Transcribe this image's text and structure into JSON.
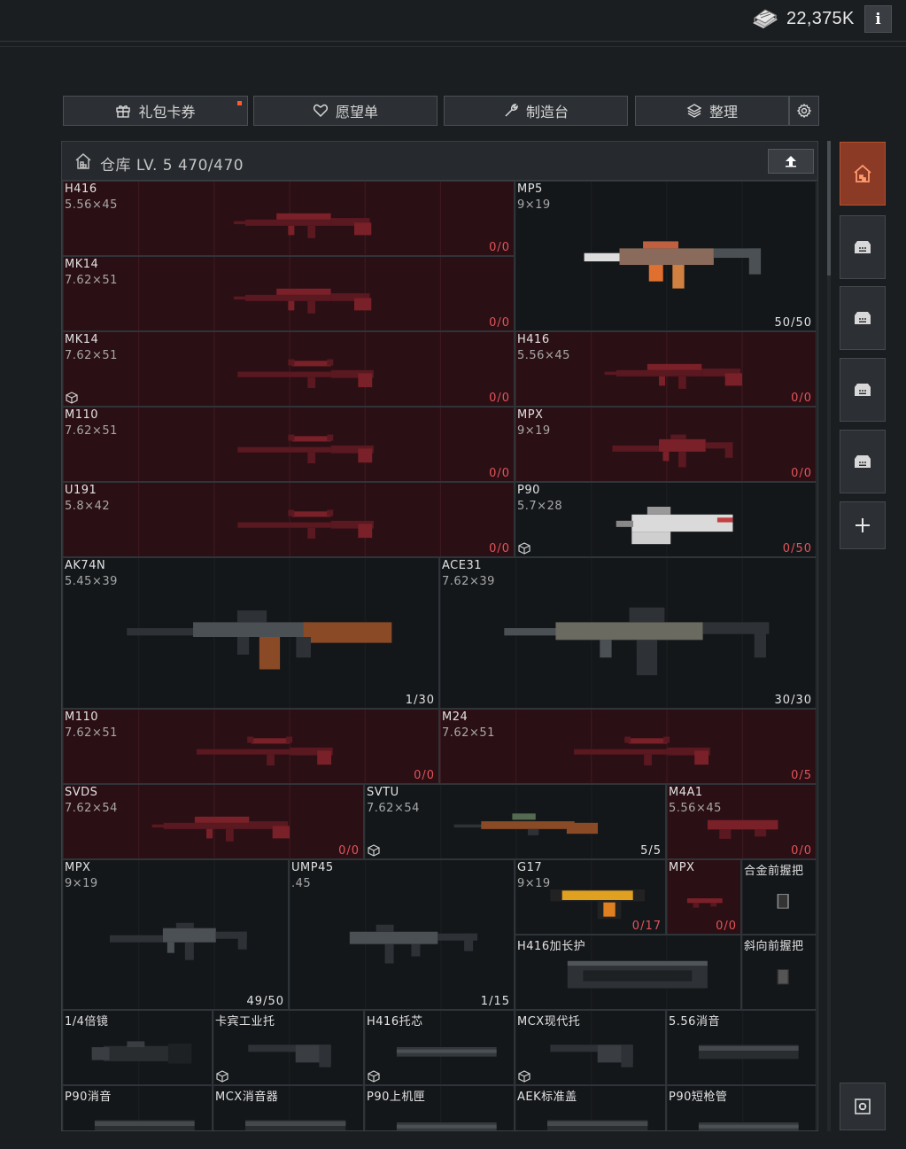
{
  "header": {
    "currency_icon": "book-stack-icon",
    "currency_amount": "22,375K",
    "info_label": "i"
  },
  "toolbar": {
    "gift_label": "礼包卡券",
    "wishlist_label": "愿望单",
    "workbench_label": "制造台",
    "sort_label": "整理"
  },
  "warehouse": {
    "title": "仓库 LV. 5 470/470"
  },
  "colors": {
    "accent": "#b4512f",
    "unavailable": "#2a0f14",
    "zero_count": "#e2545a"
  },
  "items": [
    {
      "name": "H416",
      "caliber": "5.56×45",
      "count": "0/0"
    },
    {
      "name": "MP5",
      "caliber": "9×19",
      "count": "50/50"
    },
    {
      "name": "MK14",
      "caliber": "7.62×51",
      "count": "0/0"
    },
    {
      "name": "MK14",
      "caliber": "7.62×51",
      "count": "0/0"
    },
    {
      "name": "H416",
      "caliber": "5.56×45",
      "count": "0/0"
    },
    {
      "name": "M110",
      "caliber": "7.62×51",
      "count": "0/0"
    },
    {
      "name": "MPX",
      "caliber": "9×19",
      "count": "0/0"
    },
    {
      "name": "U191",
      "caliber": "5.8×42",
      "count": "0/0"
    },
    {
      "name": "P90",
      "caliber": "5.7×28",
      "count": "0/50"
    },
    {
      "name": "AK74N",
      "caliber": "5.45×39",
      "count": "1/30"
    },
    {
      "name": "ACE31",
      "caliber": "7.62×39",
      "count": "30/30"
    },
    {
      "name": "M110",
      "caliber": "7.62×51",
      "count": "0/0"
    },
    {
      "name": "M24",
      "caliber": "7.62×51",
      "count": "0/5"
    },
    {
      "name": "SVDS",
      "caliber": "7.62×54",
      "count": "0/0"
    },
    {
      "name": "SVTU",
      "caliber": "7.62×54",
      "count": "5/5"
    },
    {
      "name": "M4A1",
      "caliber": "5.56×45",
      "count": "0/0"
    },
    {
      "name": "MPX",
      "caliber": "9×19",
      "count": "49/50"
    },
    {
      "name": "UMP45",
      "caliber": ".45",
      "count": "1/15"
    },
    {
      "name": "G17",
      "caliber": "9×19",
      "count": "0/17"
    },
    {
      "name": "MPX",
      "caliber": "",
      "count": "0/0"
    },
    {
      "name": "合金前握把",
      "caliber": "",
      "count": ""
    },
    {
      "name": "H416加长护",
      "caliber": "",
      "count": ""
    },
    {
      "name": "斜向前握把",
      "caliber": "",
      "count": ""
    },
    {
      "name": "1/4倍镜",
      "caliber": "",
      "count": ""
    },
    {
      "name": "卡宾工业托",
      "caliber": "",
      "count": ""
    },
    {
      "name": "H416托芯",
      "caliber": "",
      "count": ""
    },
    {
      "name": "MCX现代托",
      "caliber": "",
      "count": ""
    },
    {
      "name": "5.56消音",
      "caliber": "",
      "count": ""
    },
    {
      "name": "P90消音",
      "caliber": "",
      "count": ""
    },
    {
      "name": "MCX消音器",
      "caliber": "",
      "count": ""
    },
    {
      "name": "P90上机匣",
      "caliber": "",
      "count": ""
    },
    {
      "name": "AEK标准盖",
      "caliber": "",
      "count": ""
    },
    {
      "name": "P90短枪管",
      "caliber": "",
      "count": ""
    }
  ],
  "side_tabs": [
    "home-icon",
    "storage-box-icon",
    "storage-box-icon",
    "storage-box-icon",
    "storage-box-icon",
    "plus-icon",
    "safe-icon"
  ]
}
